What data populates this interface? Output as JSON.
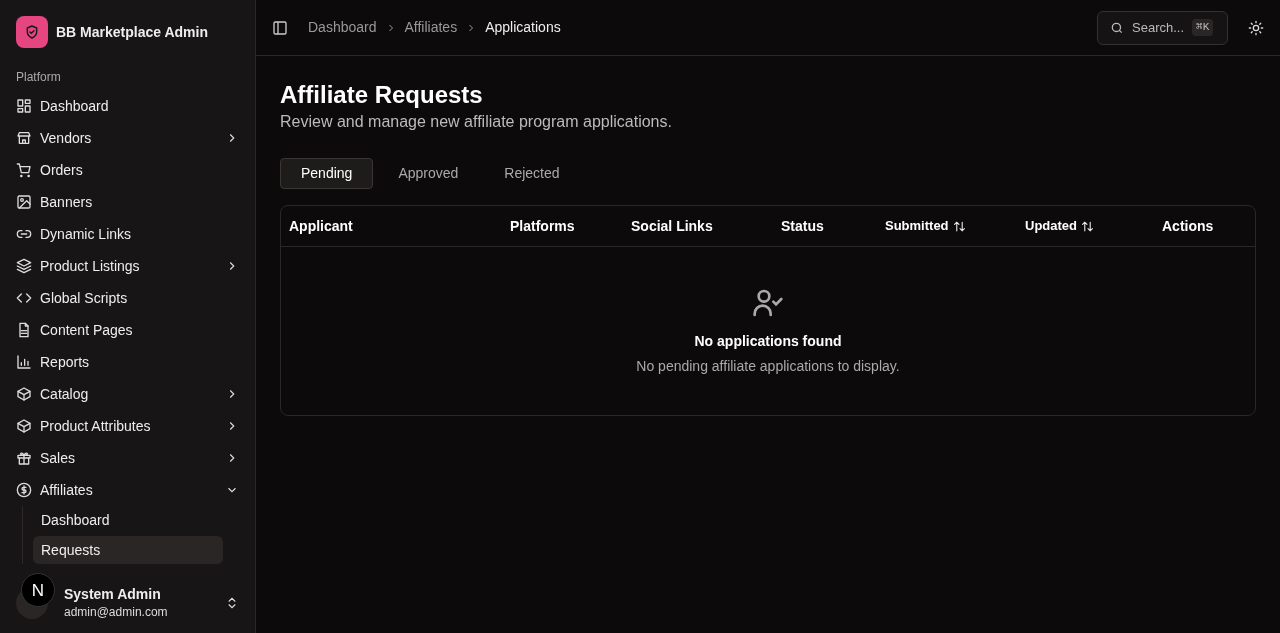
{
  "app": {
    "title": "BB Marketplace Admin"
  },
  "sidebar": {
    "section": "Platform",
    "items": [
      {
        "label": "Dashboard"
      },
      {
        "label": "Vendors",
        "expanded": false
      },
      {
        "label": "Orders"
      },
      {
        "label": "Banners"
      },
      {
        "label": "Dynamic Links"
      },
      {
        "label": "Product Listings",
        "expanded": false
      },
      {
        "label": "Global Scripts"
      },
      {
        "label": "Content Pages"
      },
      {
        "label": "Reports"
      },
      {
        "label": "Catalog",
        "expanded": false
      },
      {
        "label": "Product Attributes",
        "expanded": false
      },
      {
        "label": "Sales",
        "expanded": false
      },
      {
        "label": "Affiliates",
        "expanded": true,
        "children": [
          {
            "label": "Dashboard",
            "selected": false
          },
          {
            "label": "Requests",
            "selected": true
          }
        ]
      }
    ]
  },
  "user": {
    "name": "System Admin",
    "email": "admin@admin.com"
  },
  "dev_indicator": {
    "label": "N"
  },
  "breadcrumbs": [
    {
      "label": "Dashboard",
      "current": false
    },
    {
      "label": "Affiliates",
      "current": false
    },
    {
      "label": "Applications",
      "current": true
    }
  ],
  "search": {
    "placeholder": "Search...",
    "shortcut": "⌘K"
  },
  "page": {
    "title": "Affiliate Requests",
    "subtitle": "Review and manage new affiliate program applications."
  },
  "tabs": [
    {
      "label": "Pending",
      "selected": true
    },
    {
      "label": "Approved",
      "selected": false
    },
    {
      "label": "Rejected",
      "selected": false
    }
  ],
  "table": {
    "columns": [
      {
        "label": "Applicant",
        "sortable": false
      },
      {
        "label": "Platforms",
        "sortable": false
      },
      {
        "label": "Social Links",
        "sortable": false
      },
      {
        "label": "Status",
        "sortable": false
      },
      {
        "label": "Submitted",
        "sortable": true
      },
      {
        "label": "Updated",
        "sortable": true
      },
      {
        "label": "Actions",
        "sortable": false
      }
    ],
    "empty": {
      "title": "No applications found",
      "message": "No pending affiliate applications to display."
    }
  }
}
